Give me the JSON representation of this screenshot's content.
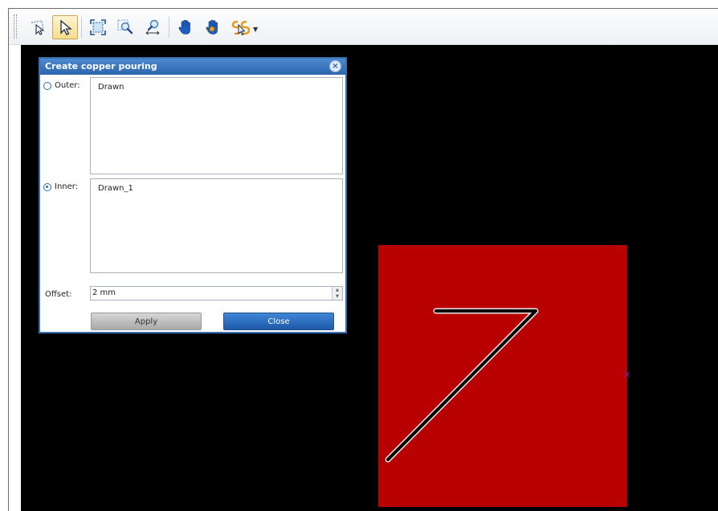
{
  "toolbar": {
    "buttons": [
      {
        "icon": "lasso-select-icon"
      },
      {
        "icon": "pointer-select-icon",
        "active": true
      },
      {
        "icon": "zoom-extents-icon"
      },
      {
        "icon": "zoom-window-icon"
      },
      {
        "icon": "zoom-horizontal-icon"
      },
      {
        "icon": "pan-hand-icon"
      },
      {
        "icon": "pan-hand-alt-icon"
      },
      {
        "icon": "snap-tool-icon",
        "dropdown": true
      }
    ]
  },
  "dialog": {
    "title": "Create copper pouring",
    "close_glyph": "×",
    "outer": {
      "label": "Outer:",
      "items": [
        "Drawn"
      ],
      "selected": false
    },
    "inner": {
      "label": "Inner:",
      "items": [
        "Drawn_1"
      ],
      "selected": true
    },
    "offset": {
      "label": "Offset:",
      "value": "2 mm"
    },
    "apply_label": "Apply",
    "close_label": "Close"
  },
  "canvas": {
    "background": "#000000",
    "copper_color": "#b80000",
    "cursor_glyph": "×"
  },
  "colors": {
    "accent": "#2a64ad",
    "dialog_title_bg": "#3a78c4",
    "active_tool": "#f7dc8a"
  }
}
